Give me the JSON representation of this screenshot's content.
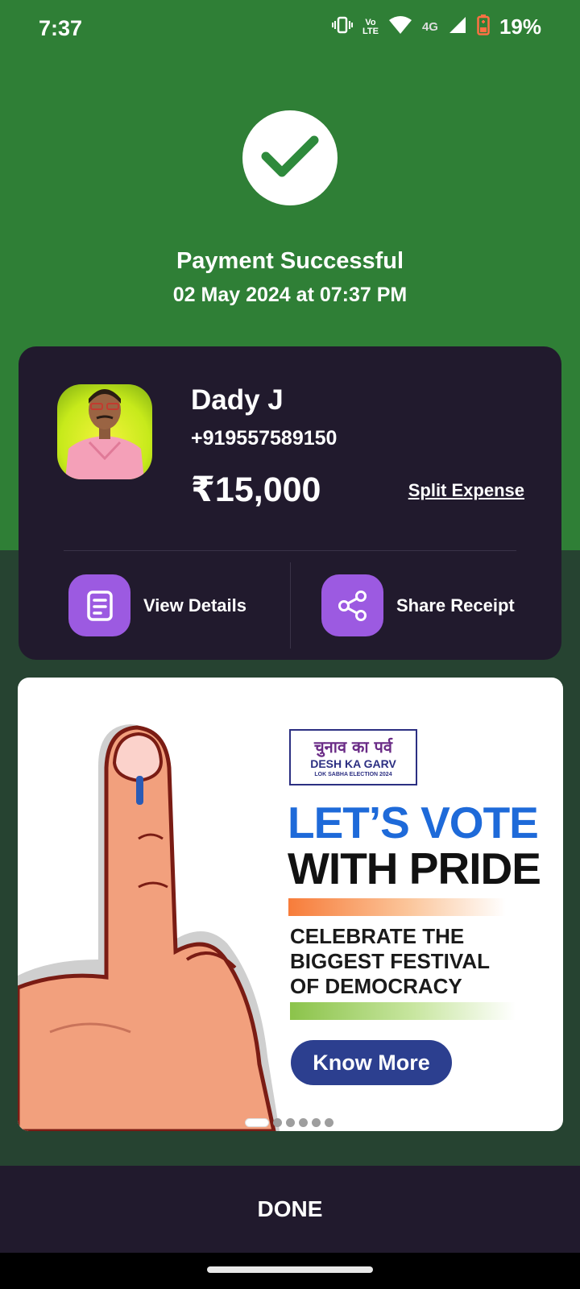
{
  "status_bar": {
    "time": "7:37",
    "volte_top": "Vo",
    "volte_bottom": "LTE",
    "network": "4G",
    "battery": "19%"
  },
  "header": {
    "title": "Payment Successful",
    "datetime": "02 May 2024 at 07:37 PM"
  },
  "payee": {
    "name": "Dady J",
    "phone": "+919557589150",
    "amount": "₹15,000",
    "split_label": "Split Expense"
  },
  "actions": {
    "view_details": "View Details",
    "share_receipt": "Share Receipt"
  },
  "banner": {
    "logo_hindi": "चुनाव का पर्व",
    "logo_english": "DESH KA GARV",
    "logo_subtitle": "LOK SABHA ELECTION 2024",
    "headline_1": "LET’S VOTE",
    "headline_2": "WITH PRIDE",
    "body_line_1": "CELEBRATE THE",
    "body_line_2": "BIGGEST FESTIVAL",
    "body_line_3": "OF DEMOCRACY",
    "cta": "Know More",
    "slide_count": 6,
    "active_slide": 1
  },
  "footer": {
    "done_label": "DONE"
  },
  "colors": {
    "success_green": "#2f7f36",
    "card_bg": "#211a2d",
    "accent_purple": "#9c5ae1",
    "vote_blue": "#1e6ad9",
    "cta_blue": "#2c3f8f"
  }
}
